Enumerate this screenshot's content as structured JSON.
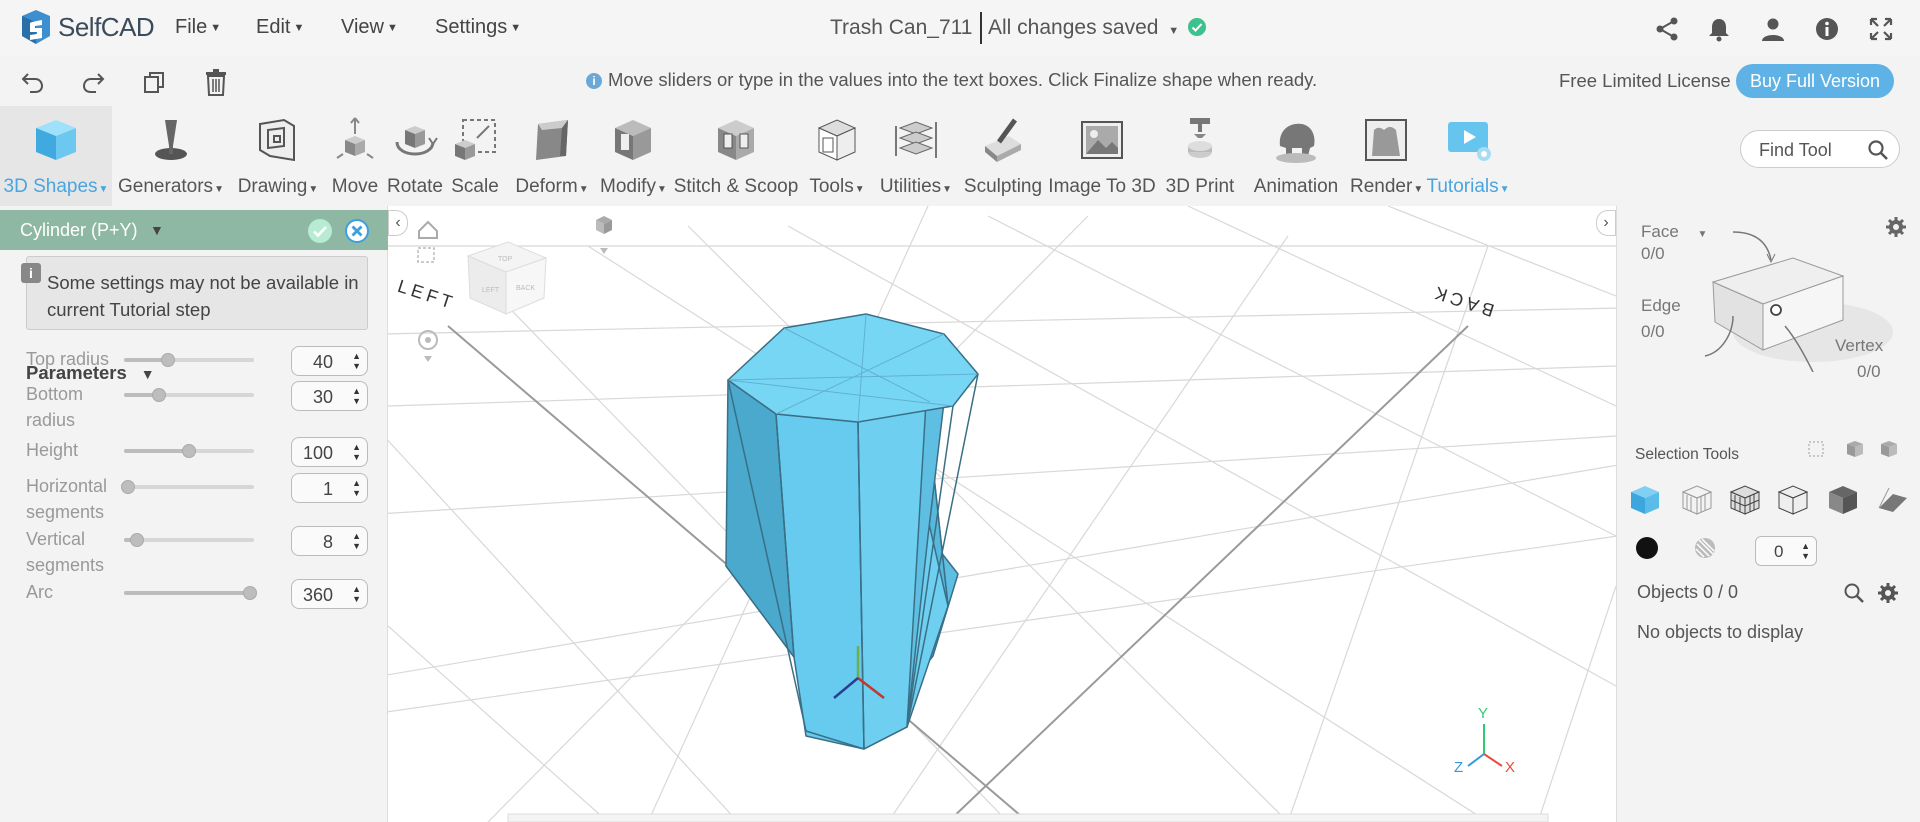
{
  "app": {
    "name": "SelfCAD"
  },
  "menus": [
    "File",
    "Edit",
    "View",
    "Settings"
  ],
  "document": {
    "title": "Trash Can_711",
    "save_status": "All changes saved"
  },
  "hint": "Move sliders or type in the values into the text boxes. Click Finalize shape when ready.",
  "license": {
    "text": "Free Limited License",
    "buy_label": "Buy Full Version"
  },
  "ribbon": {
    "tools": [
      {
        "label": "3D Shapes",
        "dropdown": true,
        "icon": "cube-icon"
      },
      {
        "label": "Generators",
        "dropdown": true,
        "icon": "generator-icon"
      },
      {
        "label": "Drawing",
        "dropdown": true,
        "icon": "drawing-icon"
      },
      {
        "label": "Move",
        "dropdown": false,
        "icon": "move-icon"
      },
      {
        "label": "Rotate",
        "dropdown": false,
        "icon": "rotate-icon"
      },
      {
        "label": "Scale",
        "dropdown": false,
        "icon": "scale-icon"
      },
      {
        "label": "Deform",
        "dropdown": true,
        "icon": "deform-icon"
      },
      {
        "label": "Modify",
        "dropdown": true,
        "icon": "modify-icon"
      },
      {
        "label": "Stitch & Scoop",
        "dropdown": false,
        "icon": "stitch-scoop-icon"
      },
      {
        "label": "Tools",
        "dropdown": true,
        "icon": "tools-icon"
      },
      {
        "label": "Utilities",
        "dropdown": true,
        "icon": "utilities-icon"
      },
      {
        "label": "Sculpting",
        "dropdown": false,
        "icon": "sculpting-icon"
      },
      {
        "label": "Image To 3D",
        "dropdown": false,
        "icon": "image-to-3d-icon"
      },
      {
        "label": "3D Print",
        "dropdown": false,
        "icon": "3d-print-icon"
      },
      {
        "label": "Animation",
        "dropdown": false,
        "icon": "animation-icon"
      },
      {
        "label": "Render",
        "dropdown": true,
        "icon": "render-icon"
      },
      {
        "label": "Tutorials",
        "dropdown": true,
        "icon": "tutorials-icon"
      }
    ],
    "find_tool_placeholder": "Find Tool"
  },
  "shape_panel": {
    "title": "Cylinder (P+Y)",
    "tutorial_note": "Some settings may not be available in current Tutorial step",
    "parameters_title": "Parameters",
    "params": [
      {
        "name": "Top radius",
        "value": "40",
        "level": 0.33
      },
      {
        "name": "Bottom radius",
        "value": "30",
        "level": 0.25
      },
      {
        "name": "Height",
        "value": "100",
        "level": 0.5
      },
      {
        "name": "Horizontal segments",
        "value": "1",
        "level": 0.0
      },
      {
        "name": "Vertical segments",
        "value": "8",
        "level": 0.07
      },
      {
        "name": "Arc",
        "value": "360",
        "level": 1.0
      }
    ]
  },
  "viewport": {
    "labels": [
      "LEFT",
      "BACK"
    ],
    "axes": {
      "x": "X",
      "y": "Y",
      "z": "Z"
    },
    "colors": {
      "shape": "#6ccff0",
      "shape_dark": "#4fb3d6",
      "edge": "#3a6f86"
    }
  },
  "selection_panel": {
    "face_label": "Face",
    "face_count": "0/0",
    "edge_label": "Edge",
    "edge_count": "0/0",
    "vertex_label": "Vertex",
    "vertex_count": "0/0",
    "tools_title": "Selection Tools",
    "size_value": "0",
    "objects_label": "Objects 0 / 0",
    "no_objects": "No objects to display"
  },
  "colors": {
    "accent": "#5fb2e5",
    "panel_header": "#8fb8a4"
  }
}
